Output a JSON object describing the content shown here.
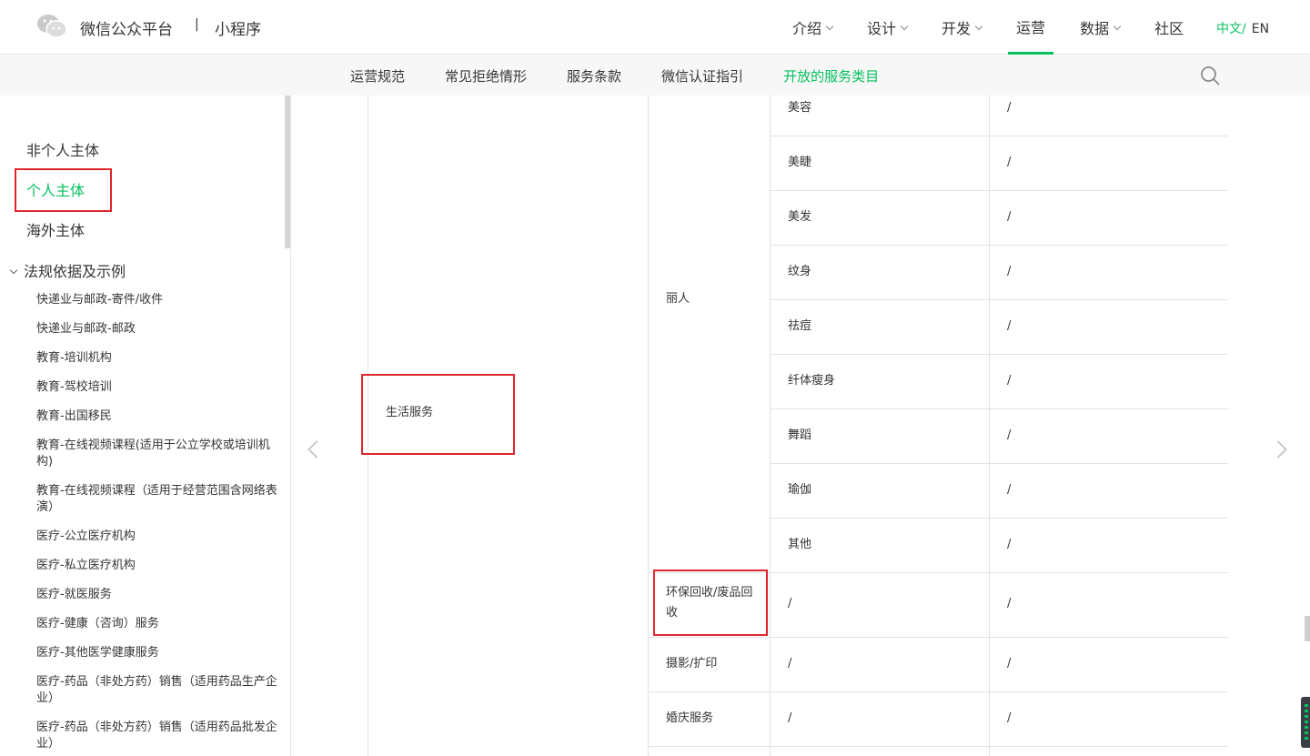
{
  "header": {
    "brand": "微信公众平台",
    "separator": "|",
    "product": "小程序",
    "nav": [
      {
        "label": "介绍",
        "has_dropdown": true
      },
      {
        "label": "设计",
        "has_dropdown": true
      },
      {
        "label": "开发",
        "has_dropdown": true
      },
      {
        "label": "运营",
        "has_dropdown": false,
        "active": true
      },
      {
        "label": "数据",
        "has_dropdown": true
      },
      {
        "label": "社区",
        "has_dropdown": false
      }
    ],
    "lang_cn": "中文",
    "lang_sep": "/",
    "lang_en": "EN",
    "accent_color": "#07c160"
  },
  "subnav": {
    "items": [
      "运营规范",
      "常见拒绝情形",
      "服务条款",
      "微信认证指引",
      "开放的服务类目"
    ],
    "active_index": 4,
    "search_icon": "search-icon"
  },
  "sidebar": {
    "top_items": [
      "非个人主体",
      "个人主体",
      "海外主体"
    ],
    "active_index": 1,
    "group_label": "法规依据及示例",
    "sub_items": [
      "快递业与邮政-寄件/收件",
      "快递业与邮政-邮政",
      "教育-培训机构",
      "教育-驾校培训",
      "教育-出国移民",
      "教育-在线视频课程(适用于公立学校或培训机构)",
      "教育-在线视频课程（适用于经营范围含网络表演）",
      "医疗-公立医疗机构",
      "医疗-私立医疗机构",
      "医疗-就医服务",
      "医疗-健康（咨询）服务",
      "医疗-其他医学健康服务",
      "医疗-药品（非处方药）销售（适用药品生产企业）",
      "医疗-药品（非处方药）销售（适用药品批发企业）"
    ]
  },
  "table": {
    "category_l1": "生活服务",
    "group_l2": "丽人",
    "beauty_rows": [
      {
        "name": "美容",
        "req": "/"
      },
      {
        "name": "美睫",
        "req": "/"
      },
      {
        "name": "美发",
        "req": "/"
      },
      {
        "name": "纹身",
        "req": "/"
      },
      {
        "name": "祛痘",
        "req": "/"
      },
      {
        "name": "纤体瘦身",
        "req": "/"
      },
      {
        "name": "舞蹈",
        "req": "/"
      },
      {
        "name": "瑜伽",
        "req": "/"
      },
      {
        "name": "其他",
        "req": "/"
      }
    ],
    "other_rows": [
      {
        "name": "环保回收/废品回收",
        "l3": "/",
        "req": "/"
      },
      {
        "name": "摄影/扩印",
        "l3": "/",
        "req": "/"
      },
      {
        "name": "婚庆服务",
        "l3": "/",
        "req": "/"
      }
    ]
  },
  "highlight_color": "#e0262d"
}
